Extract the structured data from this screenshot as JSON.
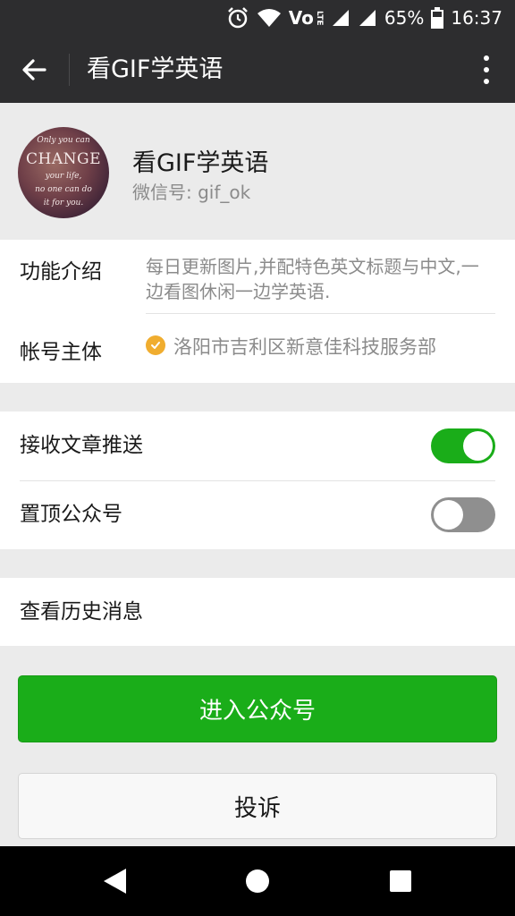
{
  "status_bar": {
    "battery": "65%",
    "time": "16:37",
    "volte_label": "Vo",
    "lte_label": "LTE"
  },
  "app_bar": {
    "title": "看GIF学英语"
  },
  "profile": {
    "name": "看GIF学英语",
    "wechat_id": "微信号: gif_ok",
    "avatar_text": [
      "Only you can",
      "CHANGE",
      "your life,",
      "no one can do",
      "it for you."
    ]
  },
  "info": {
    "intro_label": "功能介绍",
    "intro_text": "每日更新图片,并配特色英文标题与中文,一边看图休闲一边学英语.",
    "entity_label": "帐号主体",
    "entity_text": "洛阳市吉利区新意佳科技服务部"
  },
  "settings": {
    "receive_push_label": "接收文章推送",
    "receive_push_on": true,
    "pin_top_label": "置顶公众号",
    "pin_top_on": false
  },
  "history": {
    "label": "查看历史消息"
  },
  "buttons": {
    "enter_label": "进入公众号",
    "complain_label": "投诉"
  },
  "colors": {
    "accent_green": "#1aad19",
    "bar_dark": "#2d2d2f",
    "verify_badge": "#f0ad2f"
  }
}
